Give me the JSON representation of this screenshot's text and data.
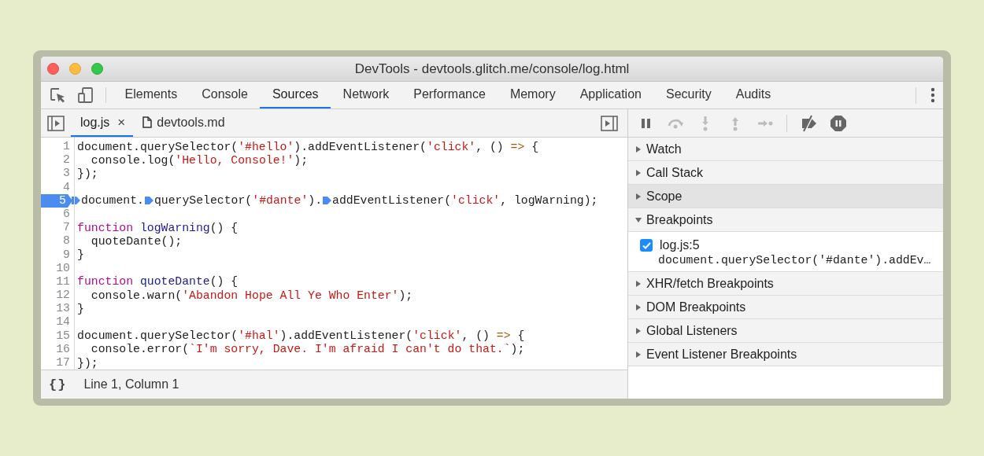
{
  "window": {
    "title": "DevTools - devtools.glitch.me/console/log.html"
  },
  "tabs": [
    {
      "label": "Elements",
      "selected": false
    },
    {
      "label": "Console",
      "selected": false
    },
    {
      "label": "Sources",
      "selected": true
    },
    {
      "label": "Network",
      "selected": false
    },
    {
      "label": "Performance",
      "selected": false
    },
    {
      "label": "Memory",
      "selected": false
    },
    {
      "label": "Application",
      "selected": false
    },
    {
      "label": "Security",
      "selected": false
    },
    {
      "label": "Audits",
      "selected": false
    }
  ],
  "file_tabs": [
    {
      "label": "log.js",
      "close": "×",
      "kind": "script",
      "selected": true
    },
    {
      "label": "devtools.md",
      "kind": "file",
      "selected": false
    }
  ],
  "debugger_buttons": [
    {
      "kind": "pause",
      "disabled": false
    },
    {
      "kind": "step-over",
      "disabled": true
    },
    {
      "kind": "step-into",
      "disabled": true
    },
    {
      "kind": "step-out",
      "disabled": true
    },
    {
      "kind": "step",
      "disabled": true
    },
    {
      "kind": "deactivate",
      "disabled": false
    },
    {
      "kind": "pause-exceptions",
      "disabled": false
    }
  ],
  "editor": {
    "lines": [
      {
        "number": "1",
        "breakpoint": false,
        "tokens": [
          {
            "kind": "plain",
            "text": "document.querySelector("
          },
          {
            "kind": "string",
            "text": "'#hello'"
          },
          {
            "kind": "plain",
            "text": ").addEventListener("
          },
          {
            "kind": "string",
            "text": "'click'"
          },
          {
            "kind": "plain",
            "text": ", () "
          },
          {
            "kind": "arrow",
            "text": "=>"
          },
          {
            "kind": "plain",
            "text": " {"
          }
        ]
      },
      {
        "number": "2",
        "breakpoint": false,
        "tokens": [
          {
            "kind": "plain",
            "text": "  console.log("
          },
          {
            "kind": "string",
            "text": "'Hello, Console!'"
          },
          {
            "kind": "plain",
            "text": ");"
          }
        ]
      },
      {
        "number": "3",
        "breakpoint": false,
        "tokens": [
          {
            "kind": "plain",
            "text": "});"
          }
        ]
      },
      {
        "number": "4",
        "breakpoint": false
      },
      {
        "number": "5",
        "breakpoint": true,
        "tokens": [
          {
            "kind": "marker"
          },
          {
            "kind": "plain",
            "text": "document."
          },
          {
            "kind": "marker"
          },
          {
            "kind": "plain",
            "text": "querySelector("
          },
          {
            "kind": "string",
            "text": "'#dante'"
          },
          {
            "kind": "plain",
            "text": ")."
          },
          {
            "kind": "marker"
          },
          {
            "kind": "plain",
            "text": "addEventListener("
          },
          {
            "kind": "string",
            "text": "'click'"
          },
          {
            "kind": "plain",
            "text": ", logWarning);"
          }
        ]
      },
      {
        "number": "6",
        "breakpoint": false
      },
      {
        "number": "7",
        "breakpoint": false,
        "tokens": [
          {
            "kind": "keyword",
            "text": "function "
          },
          {
            "kind": "def",
            "text": "logWarning"
          },
          {
            "kind": "plain",
            "text": "() {"
          }
        ]
      },
      {
        "number": "8",
        "breakpoint": false,
        "tokens": [
          {
            "kind": "plain",
            "text": "  quoteDante();"
          }
        ]
      },
      {
        "number": "9",
        "breakpoint": false,
        "tokens": [
          {
            "kind": "plain",
            "text": "}"
          }
        ]
      },
      {
        "number": "10",
        "breakpoint": false
      },
      {
        "number": "11",
        "breakpoint": false,
        "tokens": [
          {
            "kind": "keyword",
            "text": "function "
          },
          {
            "kind": "def",
            "text": "quoteDante"
          },
          {
            "kind": "plain",
            "text": "() {"
          }
        ]
      },
      {
        "number": "12",
        "breakpoint": false,
        "tokens": [
          {
            "kind": "plain",
            "text": "  console.warn("
          },
          {
            "kind": "string",
            "text": "'Abandon Hope All Ye Who Enter'"
          },
          {
            "kind": "plain",
            "text": ");"
          }
        ]
      },
      {
        "number": "13",
        "breakpoint": false,
        "tokens": [
          {
            "kind": "plain",
            "text": "}"
          }
        ]
      },
      {
        "number": "14",
        "breakpoint": false
      },
      {
        "number": "15",
        "breakpoint": false,
        "tokens": [
          {
            "kind": "plain",
            "text": "document.querySelector("
          },
          {
            "kind": "string",
            "text": "'#hal'"
          },
          {
            "kind": "plain",
            "text": ").addEventListener("
          },
          {
            "kind": "string",
            "text": "'click'"
          },
          {
            "kind": "plain",
            "text": ", () "
          },
          {
            "kind": "arrow",
            "text": "=>"
          },
          {
            "kind": "plain",
            "text": " {"
          }
        ]
      },
      {
        "number": "16",
        "breakpoint": false,
        "tokens": [
          {
            "kind": "plain",
            "text": "  console.error("
          },
          {
            "kind": "string",
            "text": "`I'm sorry, Dave. I'm afraid I can't do that.`"
          },
          {
            "kind": "plain",
            "text": ");"
          }
        ]
      },
      {
        "number": "17",
        "breakpoint": false,
        "tokens": [
          {
            "kind": "plain",
            "text": "});"
          }
        ]
      }
    ]
  },
  "status_bar": {
    "format_button": "{}",
    "position": "Line 1, Column 1"
  },
  "sidebar": {
    "sections": [
      {
        "title": "Watch",
        "expanded": false,
        "selected": false
      },
      {
        "title": "Call Stack",
        "expanded": false,
        "selected": false
      },
      {
        "title": "Scope",
        "expanded": false,
        "selected": true
      },
      {
        "title": "Breakpoints",
        "expanded": true,
        "selected": false,
        "items": [
          {
            "checked": true,
            "location": "log.js:5",
            "code": "document.querySelector('#dante').addEv…"
          }
        ]
      },
      {
        "title": "XHR/fetch Breakpoints",
        "expanded": false,
        "selected": false
      },
      {
        "title": "DOM Breakpoints",
        "expanded": false,
        "selected": false
      },
      {
        "title": "Global Listeners",
        "expanded": false,
        "selected": false
      },
      {
        "title": "Event Listener Breakpoints",
        "expanded": false,
        "selected": false
      }
    ]
  }
}
